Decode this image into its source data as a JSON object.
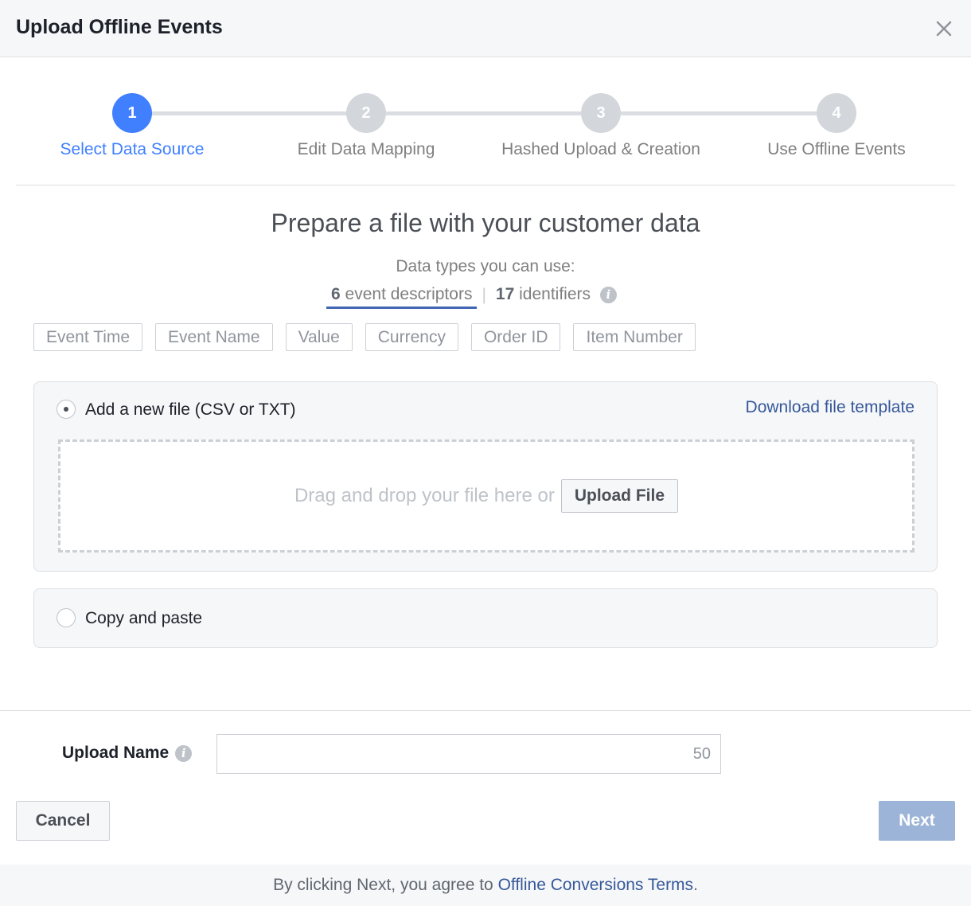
{
  "dialog": {
    "title": "Upload Offline Events",
    "close_glyph": "×"
  },
  "steps": [
    {
      "number": "1",
      "label": "Select Data Source",
      "active": true
    },
    {
      "number": "2",
      "label": "Edit Data Mapping",
      "active": false
    },
    {
      "number": "3",
      "label": "Hashed Upload & Creation",
      "active": false
    },
    {
      "number": "4",
      "label": "Use Offline Events",
      "active": false
    }
  ],
  "main": {
    "title": "Prepare a file with your customer data",
    "subtitle": "Data types you can use:",
    "tabs": {
      "descriptors_count": "6",
      "descriptors_label": "event descriptors",
      "separator": "|",
      "identifiers_count": "17",
      "identifiers_label": "identifiers"
    },
    "chips": [
      "Event Time",
      "Event Name",
      "Value",
      "Currency",
      "Order ID",
      "Item Number"
    ]
  },
  "file_option": {
    "label": "Add a new file (CSV or TXT)",
    "download_link": "Download file template",
    "drop_text": "Drag and drop your file here or",
    "upload_button": "Upload File"
  },
  "paste_option": {
    "label": "Copy and paste"
  },
  "footer": {
    "upload_name_label": "Upload Name",
    "upload_name_value": "",
    "char_count": "50",
    "cancel_label": "Cancel",
    "next_label": "Next",
    "terms_prefix": "By clicking Next, you agree to ",
    "terms_link": "Offline Conversions Terms",
    "terms_suffix": "."
  },
  "colors": {
    "accent": "#4080ff",
    "link": "#365899",
    "next_disabled": "#9cb4d8"
  }
}
